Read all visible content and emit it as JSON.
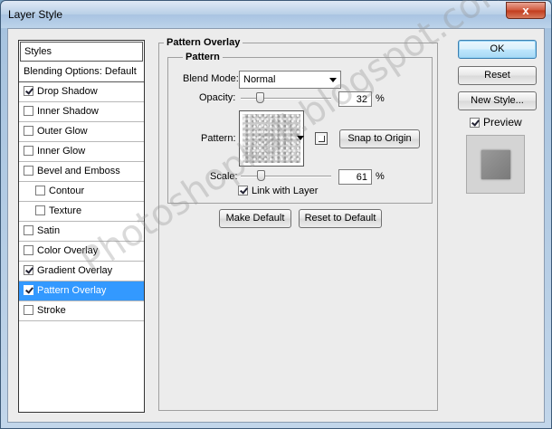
{
  "window": {
    "title": "Layer Style",
    "close_label": "x"
  },
  "styles_panel": {
    "header": "Styles",
    "items": [
      {
        "label": "Blending Options: Default",
        "checkbox": false,
        "checked": false,
        "sub": false,
        "selected": false
      },
      {
        "label": "Drop Shadow",
        "checkbox": true,
        "checked": true,
        "sub": false,
        "selected": false
      },
      {
        "label": "Inner Shadow",
        "checkbox": true,
        "checked": false,
        "sub": false,
        "selected": false
      },
      {
        "label": "Outer Glow",
        "checkbox": true,
        "checked": false,
        "sub": false,
        "selected": false
      },
      {
        "label": "Inner Glow",
        "checkbox": true,
        "checked": false,
        "sub": false,
        "selected": false
      },
      {
        "label": "Bevel and Emboss",
        "checkbox": true,
        "checked": false,
        "sub": false,
        "selected": false
      },
      {
        "label": "Contour",
        "checkbox": true,
        "checked": false,
        "sub": true,
        "selected": false
      },
      {
        "label": "Texture",
        "checkbox": true,
        "checked": false,
        "sub": true,
        "selected": false
      },
      {
        "label": "Satin",
        "checkbox": true,
        "checked": false,
        "sub": false,
        "selected": false
      },
      {
        "label": "Color Overlay",
        "checkbox": true,
        "checked": false,
        "sub": false,
        "selected": false
      },
      {
        "label": "Gradient Overlay",
        "checkbox": true,
        "checked": true,
        "sub": false,
        "selected": false
      },
      {
        "label": "Pattern Overlay",
        "checkbox": true,
        "checked": true,
        "sub": false,
        "selected": true
      },
      {
        "label": "Stroke",
        "checkbox": true,
        "checked": false,
        "sub": false,
        "selected": false
      }
    ]
  },
  "pattern_overlay": {
    "group_title": "Pattern Overlay",
    "inner_title": "Pattern",
    "blend_mode_label": "Blend Mode:",
    "blend_mode_value": "Normal",
    "opacity_label": "Opacity:",
    "opacity_value": "32",
    "opacity_fraction": 0.32,
    "percent_sign": "%",
    "pattern_label": "Pattern:",
    "snap_button": "Snap to Origin",
    "scale_label": "Scale:",
    "scale_value": "61",
    "scale_fraction": 0.61,
    "link_label": "Link with Layer",
    "link_checked": true,
    "make_default_button": "Make Default",
    "reset_default_button": "Reset to Default"
  },
  "right_buttons": {
    "ok": "OK",
    "reset": "Reset",
    "new_style": "New Style...",
    "preview_label": "Preview",
    "preview_checked": true
  },
  "watermark": "Photoshopkali.blogspot.com",
  "colors": {
    "selection": "#3399ff",
    "default_button_border": "#3c7fb1"
  }
}
